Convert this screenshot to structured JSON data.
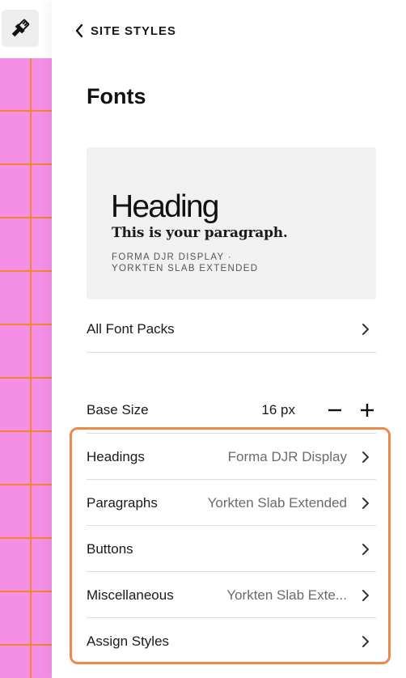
{
  "toolbar": {
    "brush_icon": "paintbrush-icon"
  },
  "header": {
    "back_label": "SITE STYLES",
    "title": "Fonts"
  },
  "preview": {
    "heading": "Heading",
    "paragraph": "This is your paragraph.",
    "heading_font": "FORMA DJR DISPLAY ·",
    "paragraph_font": "YORKTEN SLAB EXTENDED"
  },
  "all_font_packs": {
    "label": "All Font Packs"
  },
  "base_size": {
    "label": "Base Size",
    "value": "16 px"
  },
  "font_settings": [
    {
      "label": "Headings",
      "value": "Forma DJR Display"
    },
    {
      "label": "Paragraphs",
      "value": "Yorkten Slab Extended"
    },
    {
      "label": "Buttons",
      "value": ""
    },
    {
      "label": "Miscellaneous",
      "value": "Yorkten Slab Exte..."
    },
    {
      "label": "Assign Styles",
      "value": ""
    }
  ],
  "colors": {
    "canvas_pink": "#f58fe6",
    "grid_orange": "#f0862e",
    "highlight_orange": "#f0884a"
  }
}
